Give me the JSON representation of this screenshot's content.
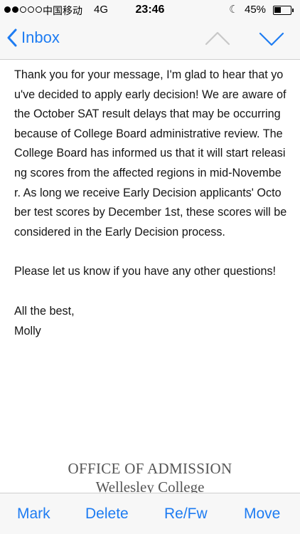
{
  "status": {
    "carrier": "中国移动",
    "network": "4G",
    "time": "23:46",
    "battery_text": "45%",
    "battery_level": 0.45
  },
  "nav": {
    "back_label": "Inbox",
    "accent": "#1e7cf2"
  },
  "message": {
    "paragraph_1": "Thank you for your message, I'm glad to hear that you've decided to apply early decision! We are aware of the October SAT result delays that may be occurring because of College Board administrative review. The College Board has informed us that it will start releasing scores from the affected regions in mid-November. As long we receive Early Decision applicants' October test scores by December 1st, these scores will be considered in the Early Decision process.",
    "paragraph_2": "Please let us know if you have any other questions!",
    "closing": "All the best,",
    "name": "Molly"
  },
  "signature": {
    "title": "OFFICE OF ADMISSION",
    "subtitle": "Wellesley College"
  },
  "toolbar": {
    "mark": "Mark",
    "delete": "Delete",
    "reply_forward": "Re/Fw",
    "move": "Move"
  }
}
